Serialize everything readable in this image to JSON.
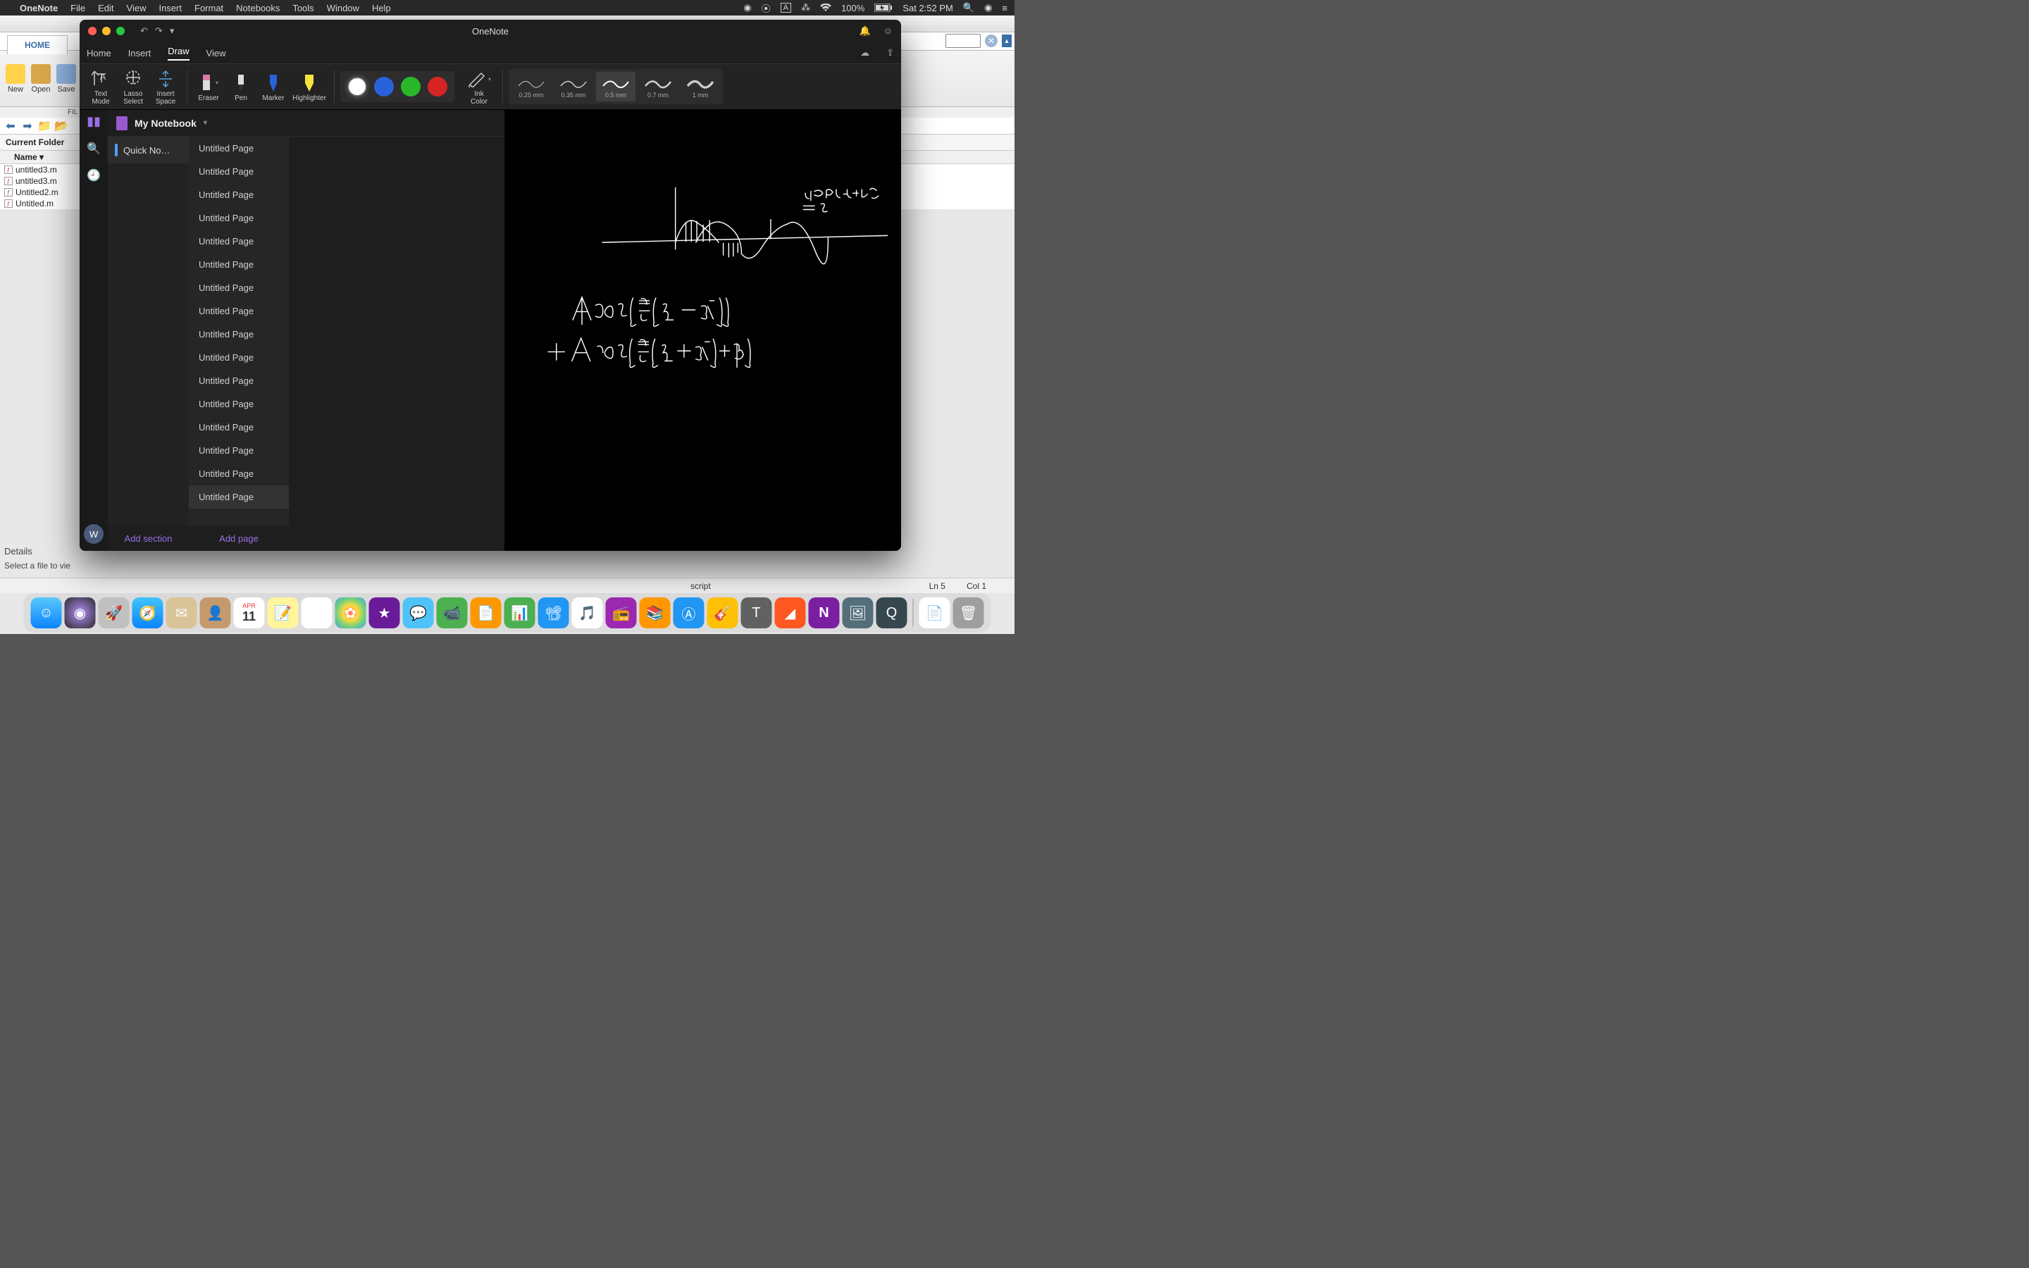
{
  "menubar": {
    "app": "OneNote",
    "items": [
      "File",
      "Edit",
      "View",
      "Insert",
      "Format",
      "Notebooks",
      "Tools",
      "Window",
      "Help"
    ],
    "battery": "100%",
    "time": "Sat 2:52 PM"
  },
  "bgwin": {
    "home": "HOME",
    "ribbon": {
      "new": "New",
      "open": "Open",
      "save": "Save"
    },
    "folder_label": "Current Folder",
    "name_header": "Name ▾",
    "files": [
      "untitled3.m",
      "untitled3.m",
      "Untitled2.m",
      "Untitled.m"
    ],
    "details": "Details",
    "select_hint": "Select a file to vie",
    "fil": "FIL",
    "status_script": "script",
    "status_ln": "Ln   5",
    "status_col": "Col   1"
  },
  "onenote": {
    "title": "OneNote",
    "tabs": [
      "Home",
      "Insert",
      "Draw",
      "View"
    ],
    "active_tab": 2,
    "tools": {
      "text_mode": "Text\nMode",
      "lasso": "Lasso\nSelect",
      "insert_space": "Insert\nSpace",
      "eraser": "Eraser",
      "pen": "Pen",
      "marker": "Marker",
      "highlighter": "Highlighter",
      "ink_color": "Ink\nColor"
    },
    "strokes": [
      "0.25 mm",
      "0.35 mm",
      "0.5 mm",
      "0.7 mm",
      "1 mm"
    ],
    "selected_stroke": 2,
    "notebook": "My Notebook",
    "section": "Quick No…",
    "pages": [
      "Untitled Page",
      "Untitled Page",
      "Untitled Page",
      "Untitled Page",
      "Untitled Page",
      "Untitled Page",
      "Untitled Page",
      "Untitled Page",
      "Untitled Page",
      "Untitled Page",
      "Untitled Page",
      "Untitled Page",
      "Untitled Page",
      "Untitled Page",
      "Untitled Page",
      "Untitled Page"
    ],
    "selected_page": 15,
    "add_section": "Add section",
    "add_page": "Add page",
    "avatar": "W"
  },
  "dock": {
    "apps": [
      "finder",
      "siri",
      "launchpad",
      "safari",
      "mail",
      "contacts",
      "calendar",
      "notes",
      "reminders",
      "photos",
      "imovie",
      "messages",
      "facetime",
      "pages",
      "numbers",
      "keynote",
      "music",
      "podcasts",
      "books",
      "appstore",
      "garageband",
      "texshop",
      "matlab",
      "onenote",
      "preview",
      "quicktime"
    ],
    "calendar_day": "11",
    "calendar_month": "APR"
  }
}
